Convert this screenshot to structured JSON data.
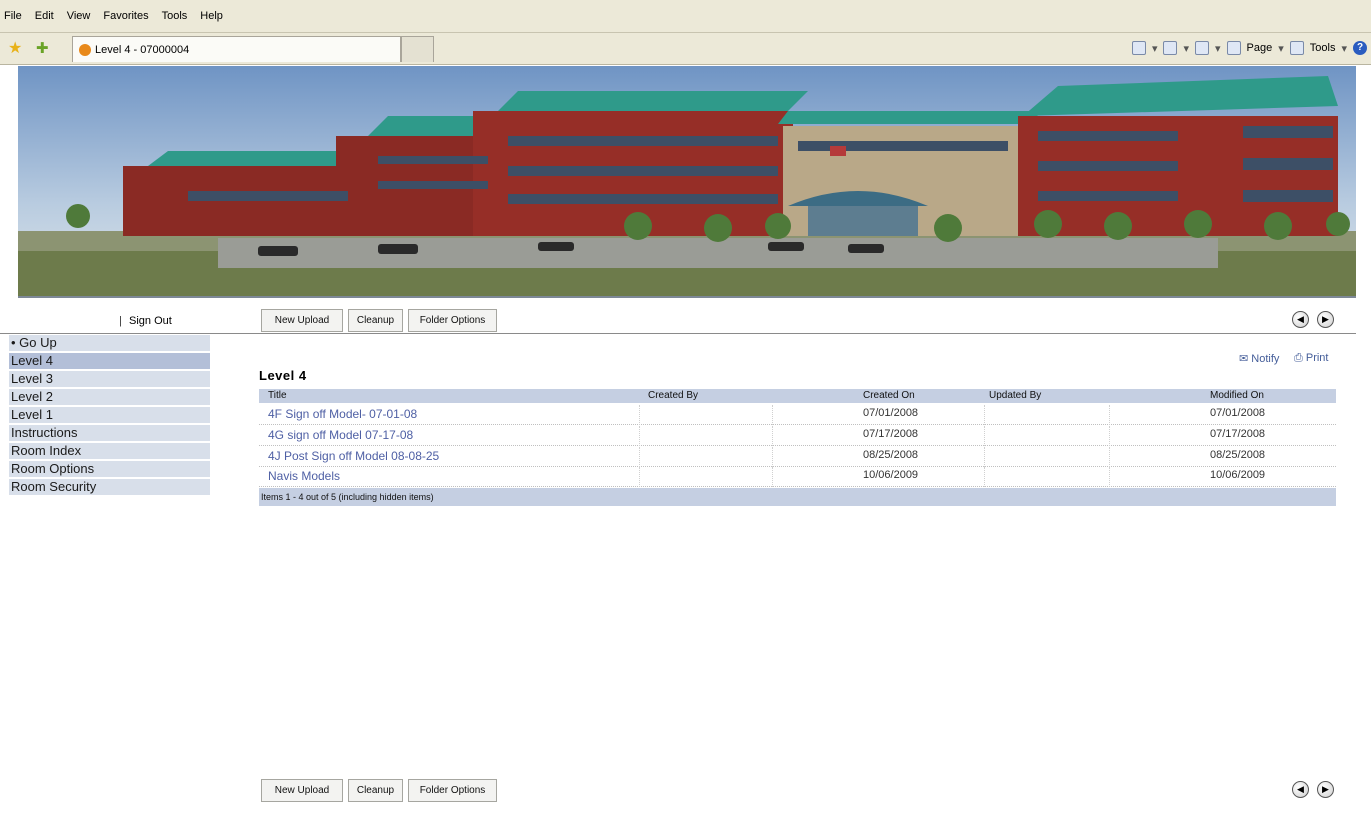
{
  "menubar": [
    "File",
    "Edit",
    "View",
    "Favorites",
    "Tools",
    "Help"
  ],
  "browser": {
    "tab_title": "Level 4 - 07000004",
    "commands": {
      "page": "Page",
      "tools": "Tools"
    }
  },
  "actions": {
    "sign_out": "Sign Out",
    "separator": "|",
    "new_upload": "New Upload",
    "cleanup": "Cleanup",
    "folder_options": "Folder Options"
  },
  "sidebar": {
    "items": [
      {
        "label": "• Go Up"
      },
      {
        "label": "Level 4"
      },
      {
        "label": "Level 3"
      },
      {
        "label": "Level 2"
      },
      {
        "label": "Level 1"
      },
      {
        "label": "Instructions"
      },
      {
        "label": "Room Index"
      },
      {
        "label": "Room Options"
      },
      {
        "label": "Room Security"
      }
    ]
  },
  "main": {
    "notify": "Notify",
    "print": "Print",
    "title": "Level 4",
    "columns": {
      "title": "Title",
      "created_by": "Created By",
      "created_on": "Created On",
      "updated_by": "Updated By",
      "modified_on": "Modified On"
    },
    "rows": [
      {
        "title": "4F Sign off Model- 07-01-08",
        "created_by": "",
        "created_on": "07/01/2008",
        "updated_by": "",
        "modified_on": "07/01/2008"
      },
      {
        "title": "4G sign off Model 07-17-08",
        "created_by": "",
        "created_on": "07/17/2008",
        "updated_by": "",
        "modified_on": "07/17/2008"
      },
      {
        "title": "4J Post Sign off Model 08-08-25",
        "created_by": "",
        "created_on": "08/25/2008",
        "updated_by": "",
        "modified_on": "08/25/2008"
      },
      {
        "title": "Navis Models",
        "created_by": "",
        "created_on": "10/06/2009",
        "updated_by": "",
        "modified_on": "10/06/2009"
      }
    ],
    "footer": "Items 1 - 4 out of 5 (including hidden items)"
  },
  "colors": {
    "link": "#4e5fa4",
    "header_bg": "#c5cfe2",
    "sidebar_bg": "#d8dfea",
    "sidebar_active": "#b3bfd8"
  }
}
